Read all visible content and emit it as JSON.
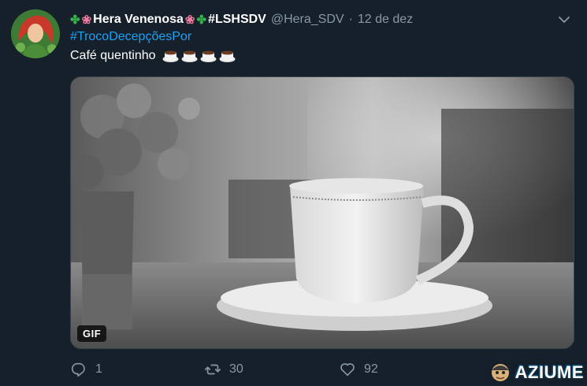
{
  "tweet": {
    "display_name": "Hera Venenosa",
    "display_name_suffix": "#LSHSDV",
    "handle": "@Hera_SDV",
    "separator": "·",
    "date": "12 de dez",
    "hashtag": "#TrocoDecepçõesPor",
    "text": "Café quentinho",
    "cup_emoji_count": 4,
    "media": {
      "badge": "GIF",
      "kind": "gif"
    }
  },
  "actions": {
    "reply_count": "1",
    "retweet_count": "30",
    "like_count": "92"
  },
  "watermark": {
    "text": "AZIUME"
  },
  "colors": {
    "background": "#15202b",
    "link": "#1da1f2",
    "muted": "#8899a6",
    "clover": "#36b04a",
    "tulip": "#f07aa0"
  },
  "icons": {
    "caret": "chevron-down-icon",
    "reply": "reply-icon",
    "retweet": "retweet-icon",
    "like": "heart-icon"
  }
}
